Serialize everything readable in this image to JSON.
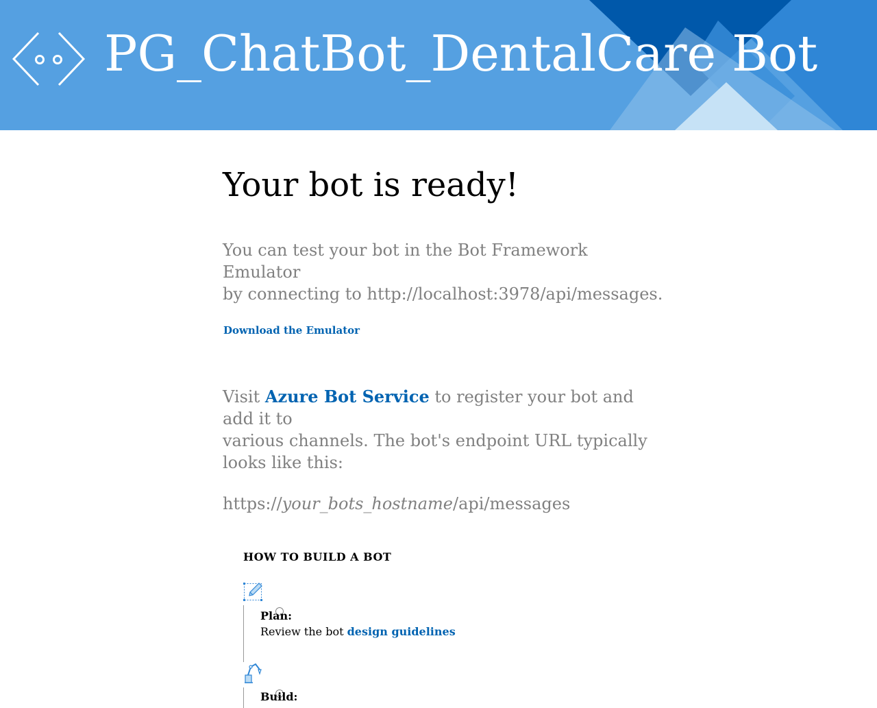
{
  "header": {
    "title": "PG_ChatBot_DentalCare Bot",
    "bot_icon": "bot-face-icon"
  },
  "main": {
    "ready_title": "Your bot is ready!",
    "emulator_line1": "You can test your bot in the Bot Framework Emulator",
    "emulator_line2": "by connecting to http://localhost:3978/api/messages.",
    "download_link": "Download the Emulator",
    "azure_prefix": "Visit ",
    "azure_link": "Azure Bot Service",
    "azure_suffix": " to register your bot and add it to",
    "azure_line2": "various channels. The bot's endpoint URL typically looks like this:",
    "endpoint_prefix": "https://",
    "endpoint_host": "your_bots_hostname",
    "endpoint_suffix": "/api/messages"
  },
  "howto": {
    "title": "HOW TO BUILD A BOT",
    "steps": [
      {
        "icon": "plan-pencil-icon",
        "label": "Plan:",
        "desc_prefix": "Review the bot ",
        "link": "design guidelines"
      },
      {
        "icon": "build-robot-arm-icon",
        "label": "Build:"
      }
    ]
  },
  "colors": {
    "header_bg": "#55a0e1",
    "link": "#0063b1",
    "gray_text": "#808080"
  }
}
